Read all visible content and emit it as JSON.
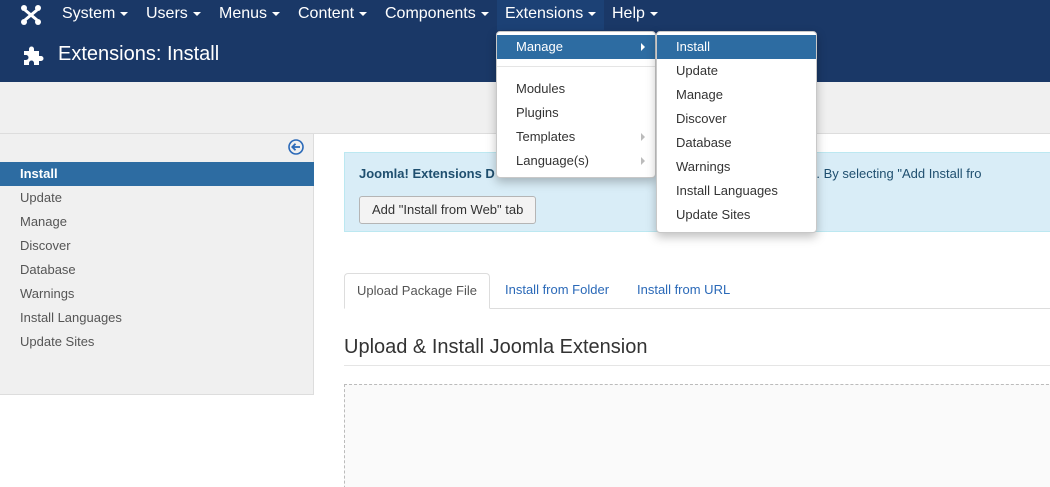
{
  "navbar": {
    "logo_icon": "joomla-logo-icon",
    "items": [
      {
        "label": "System"
      },
      {
        "label": "Users"
      },
      {
        "label": "Menus"
      },
      {
        "label": "Content"
      },
      {
        "label": "Components"
      },
      {
        "label": "Extensions"
      },
      {
        "label": "Help"
      }
    ]
  },
  "header": {
    "icon": "puzzle-icon",
    "title": "Extensions: Install"
  },
  "sidebar": {
    "toggle_icon": "circle-arrow-left-icon",
    "items": [
      {
        "label": "Install"
      },
      {
        "label": "Update"
      },
      {
        "label": "Manage"
      },
      {
        "label": "Discover"
      },
      {
        "label": "Database"
      },
      {
        "label": "Warnings"
      },
      {
        "label": "Install Languages"
      },
      {
        "label": "Update Sites"
      }
    ]
  },
  "alert": {
    "text_bold": "Joomla! Extensions D",
    "text_rest": "n this page. By selecting \"Add Install fro",
    "button_label": "Add \"Install from Web\" tab"
  },
  "tabs": [
    {
      "label": "Upload Package File"
    },
    {
      "label": "Install from Folder"
    },
    {
      "label": "Install from URL"
    }
  ],
  "section_title": "Upload & Install Joomla Extension",
  "extensions_menu": {
    "items": [
      {
        "label": "Manage"
      },
      {
        "label": "Modules"
      },
      {
        "label": "Plugins"
      },
      {
        "label": "Templates"
      },
      {
        "label": "Language(s)"
      }
    ],
    "submenu": [
      {
        "label": "Install"
      },
      {
        "label": "Update"
      },
      {
        "label": "Manage"
      },
      {
        "label": "Discover"
      },
      {
        "label": "Database"
      },
      {
        "label": "Warnings"
      },
      {
        "label": "Install Languages"
      },
      {
        "label": "Update Sites"
      }
    ]
  },
  "colors": {
    "navbar": "#1a3867",
    "accent": "#2d6ca2",
    "link": "#2a69b8",
    "alert_bg": "#d9edf7"
  }
}
